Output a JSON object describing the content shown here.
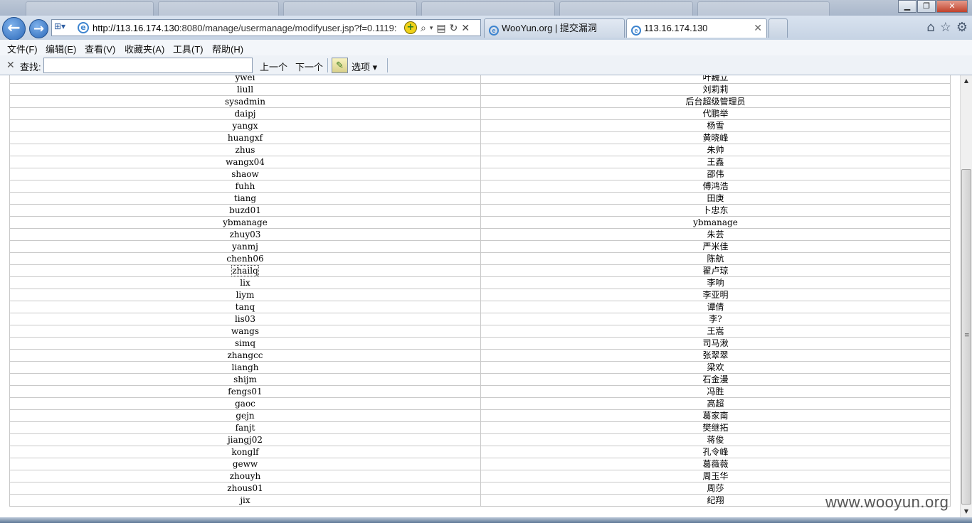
{
  "browser": {
    "address_url_host": "http://113.16.174.130",
    "address_url_path": ":8080/manage/usermanage/modifyuser.jsp?f=0.1119:",
    "tabs": [
      {
        "title": "WooYun.org | 提交漏洞"
      },
      {
        "title": "113.16.174.130"
      }
    ],
    "menu": [
      "文件(F)",
      "编辑(E)",
      "查看(V)",
      "收藏夹(A)",
      "工具(T)",
      "帮助(H)"
    ],
    "find": {
      "label": "查找:",
      "value": "",
      "prev": "上一个",
      "next": "下一个",
      "options": "选项"
    }
  },
  "users": [
    {
      "username": "ywei",
      "name": "叶巍立"
    },
    {
      "username": "liull",
      "name": "刘莉莉"
    },
    {
      "username": "sysadmin",
      "name": "后台超级管理员"
    },
    {
      "username": "daipj",
      "name": "代鹏举"
    },
    {
      "username": "yangx",
      "name": "杨雪"
    },
    {
      "username": "huangxf",
      "name": "黄晓峰"
    },
    {
      "username": "zhus",
      "name": "朱帅"
    },
    {
      "username": "wangx04",
      "name": "王鑫"
    },
    {
      "username": "shaow",
      "name": "邵伟"
    },
    {
      "username": "fuhh",
      "name": "傅鸿浩"
    },
    {
      "username": "tiang",
      "name": "田庚"
    },
    {
      "username": "buzd01",
      "name": "卜忠东"
    },
    {
      "username": "ybmanage",
      "name": "ybmanage"
    },
    {
      "username": "zhuy03",
      "name": "朱芸"
    },
    {
      "username": "yanmj",
      "name": "严米佳"
    },
    {
      "username": "chenh06",
      "name": "陈航"
    },
    {
      "username": "zhailq",
      "name": "翟卢琼"
    },
    {
      "username": "lix",
      "name": "李响"
    },
    {
      "username": "liym",
      "name": "李亚明"
    },
    {
      "username": "tanq",
      "name": "谭倩"
    },
    {
      "username": "lis03",
      "name": "李?"
    },
    {
      "username": "wangs",
      "name": "王嵩"
    },
    {
      "username": "simq",
      "name": "司马湫"
    },
    {
      "username": "zhangcc",
      "name": "张翠翠"
    },
    {
      "username": "liangh",
      "name": "梁欢"
    },
    {
      "username": "shijm",
      "name": "石金漫"
    },
    {
      "username": "fengs01",
      "name": "冯胜"
    },
    {
      "username": "gaoc",
      "name": "高超"
    },
    {
      "username": "gejn",
      "name": "葛家南"
    },
    {
      "username": "fanjt",
      "name": "樊继拓"
    },
    {
      "username": "jiangj02",
      "name": "蒋俊"
    },
    {
      "username": "konglf",
      "name": "孔令峰"
    },
    {
      "username": "geww",
      "name": "葛薇薇"
    },
    {
      "username": "zhouyh",
      "name": "周玉华"
    },
    {
      "username": "zhous01",
      "name": "周莎"
    },
    {
      "username": "jix",
      "name": "纪翔"
    }
  ],
  "watermark": "www.wooyun.org"
}
